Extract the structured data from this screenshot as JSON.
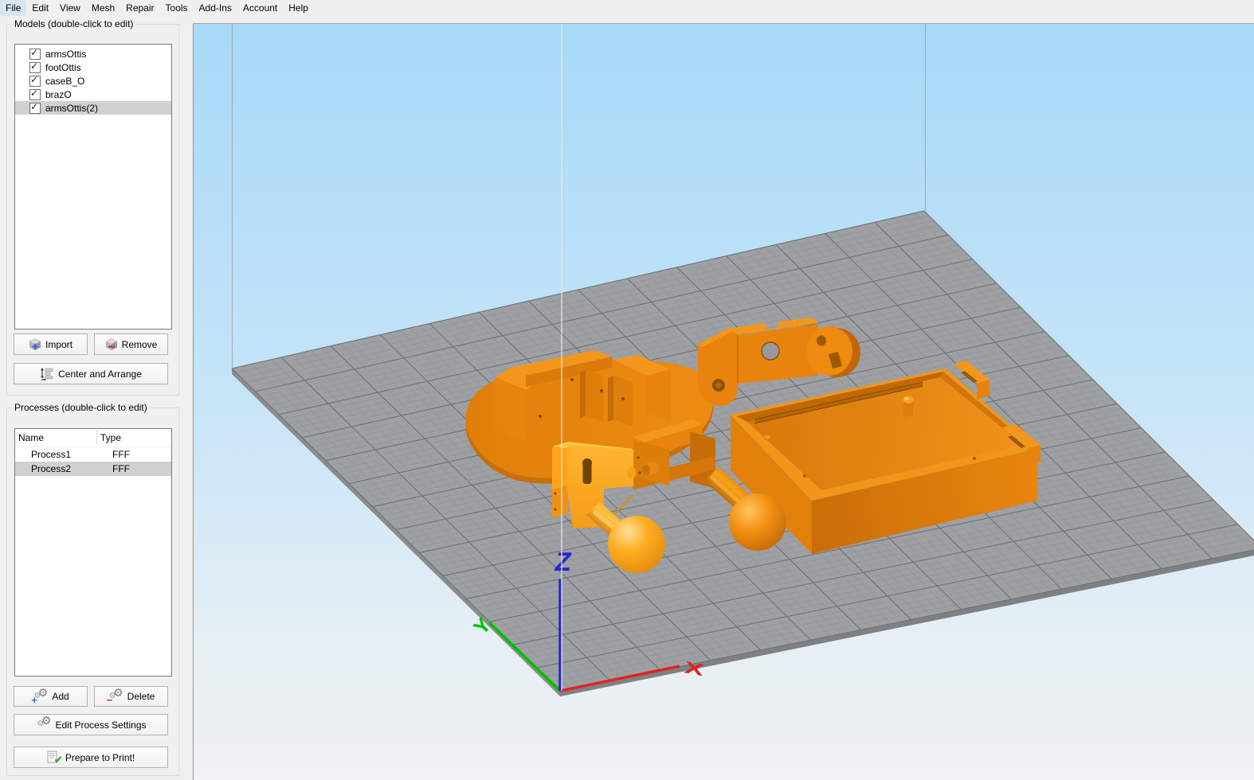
{
  "menu": {
    "items": [
      "File",
      "Edit",
      "View",
      "Mesh",
      "Repair",
      "Tools",
      "Add-Ins",
      "Account",
      "Help"
    ]
  },
  "models_panel": {
    "title": "Models (double-click to edit)",
    "items": [
      {
        "label": "armsOttis",
        "checked": true,
        "selected": false
      },
      {
        "label": "footOttis",
        "checked": true,
        "selected": false
      },
      {
        "label": "caseB_O",
        "checked": true,
        "selected": false
      },
      {
        "label": "brazO",
        "checked": true,
        "selected": false
      },
      {
        "label": "armsOttis(2)",
        "checked": true,
        "selected": true
      }
    ],
    "import_label": "Import",
    "remove_label": "Remove",
    "center_arrange_label": "Center and Arrange"
  },
  "processes_panel": {
    "title": "Processes (double-click to edit)",
    "columns": [
      "Name",
      "Type"
    ],
    "rows": [
      {
        "name": "Process1",
        "type": "FFF",
        "selected": false
      },
      {
        "name": "Process2",
        "type": "FFF",
        "selected": true
      }
    ],
    "add_label": "Add",
    "delete_label": "Delete",
    "edit_label": "Edit Process Settings",
    "prepare_label": "Prepare to Print!"
  },
  "viewport": {
    "axis_labels": {
      "x": "X",
      "y": "Y",
      "z": "Z"
    },
    "colors": {
      "axis_x": "#E02222",
      "axis_y": "#00C000",
      "axis_z": "#2525CC",
      "model_orange": "#E8830D",
      "selected_model_orange": "#FFA41C",
      "plate_gray": "#9EA0A3",
      "sky_top": "#A7D9F8",
      "sky_bottom": "#F0F2F3"
    }
  },
  "ui_colors": {
    "plus_blue": "#3A6BD0",
    "minus_red": "#D03030",
    "check_green": "#3FA535",
    "selection_gray": "#D1D1D1"
  }
}
